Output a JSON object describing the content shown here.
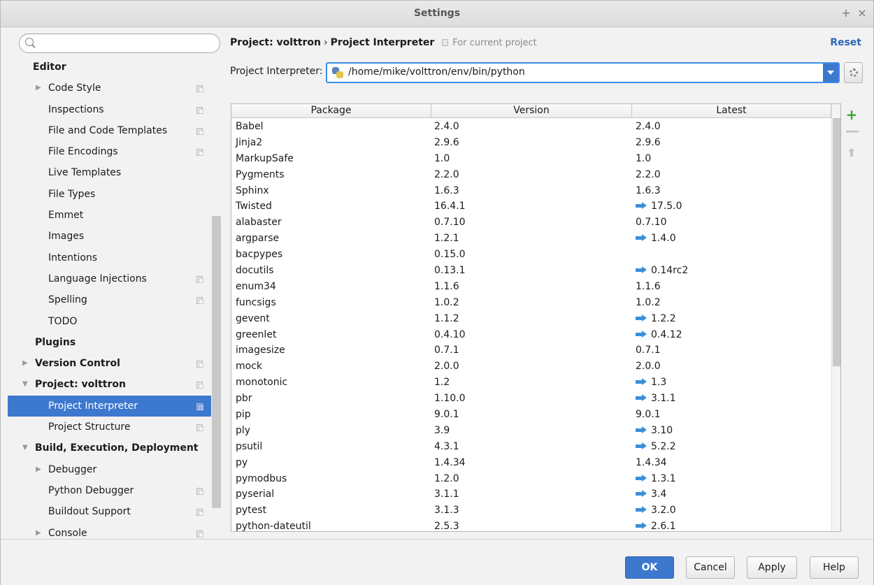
{
  "window": {
    "title": "Settings",
    "pin_glyph": "+",
    "close_glyph": "×"
  },
  "sidebar": {
    "search_placeholder": "",
    "items": [
      {
        "label": "Editor",
        "section": true,
        "arrow": "",
        "copy": false,
        "indent": 36
      },
      {
        "label": "Code Style",
        "section": false,
        "arrow": "▶",
        "copy": true,
        "indent": 58
      },
      {
        "label": "Inspections",
        "section": false,
        "arrow": "",
        "copy": true,
        "indent": 58
      },
      {
        "label": "File and Code Templates",
        "section": false,
        "arrow": "",
        "copy": true,
        "indent": 58
      },
      {
        "label": "File Encodings",
        "section": false,
        "arrow": "",
        "copy": true,
        "indent": 58
      },
      {
        "label": "Live Templates",
        "section": false,
        "arrow": "",
        "copy": false,
        "indent": 58
      },
      {
        "label": "File Types",
        "section": false,
        "arrow": "",
        "copy": false,
        "indent": 58
      },
      {
        "label": "Emmet",
        "section": false,
        "arrow": "",
        "copy": false,
        "indent": 58
      },
      {
        "label": "Images",
        "section": false,
        "arrow": "",
        "copy": false,
        "indent": 58
      },
      {
        "label": "Intentions",
        "section": false,
        "arrow": "",
        "copy": false,
        "indent": 58
      },
      {
        "label": "Language Injections",
        "section": false,
        "arrow": "",
        "copy": true,
        "indent": 58
      },
      {
        "label": "Spelling",
        "section": false,
        "arrow": "",
        "copy": true,
        "indent": 58
      },
      {
        "label": "TODO",
        "section": false,
        "arrow": "",
        "copy": false,
        "indent": 58
      },
      {
        "label": "Plugins",
        "section": true,
        "arrow": "",
        "copy": false,
        "indent": 39
      },
      {
        "label": "Version Control",
        "section": true,
        "arrow": "▶",
        "copy": true,
        "indent": 39
      },
      {
        "label": "Project: volttron",
        "section": true,
        "arrow": "▼",
        "copy": true,
        "indent": 39
      },
      {
        "label": "Project Interpreter",
        "section": false,
        "arrow": "",
        "copy": true,
        "indent": 58,
        "selected": true
      },
      {
        "label": "Project Structure",
        "section": false,
        "arrow": "",
        "copy": true,
        "indent": 58
      },
      {
        "label": "Build, Execution, Deployment",
        "section": true,
        "arrow": "▼",
        "copy": false,
        "indent": 39
      },
      {
        "label": "Debugger",
        "section": false,
        "arrow": "▶",
        "copy": false,
        "indent": 58
      },
      {
        "label": "Python Debugger",
        "section": false,
        "arrow": "",
        "copy": true,
        "indent": 58
      },
      {
        "label": "Buildout Support",
        "section": false,
        "arrow": "",
        "copy": true,
        "indent": 58
      },
      {
        "label": "Console",
        "section": false,
        "arrow": "▶",
        "copy": true,
        "indent": 58
      }
    ]
  },
  "header": {
    "breadcrumb_project": "Project: volttron",
    "breadcrumb_sep": "›",
    "breadcrumb_page": "Project Interpreter",
    "scope_note": "For current project",
    "reset": "Reset"
  },
  "interpreter": {
    "label": "Project Interpreter:",
    "value": "/home/mike/volttron/env/bin/python"
  },
  "table": {
    "columns": [
      "Package",
      "Version",
      "Latest"
    ],
    "rows": [
      {
        "package": "Babel",
        "version": "2.4.0",
        "latest": "2.4.0",
        "upgrade": false
      },
      {
        "package": "Jinja2",
        "version": "2.9.6",
        "latest": "2.9.6",
        "upgrade": false
      },
      {
        "package": "MarkupSafe",
        "version": "1.0",
        "latest": "1.0",
        "upgrade": false
      },
      {
        "package": "Pygments",
        "version": "2.2.0",
        "latest": "2.2.0",
        "upgrade": false
      },
      {
        "package": "Sphinx",
        "version": "1.6.3",
        "latest": "1.6.3",
        "upgrade": false
      },
      {
        "package": "Twisted",
        "version": "16.4.1",
        "latest": "17.5.0",
        "upgrade": true
      },
      {
        "package": "alabaster",
        "version": "0.7.10",
        "latest": "0.7.10",
        "upgrade": false
      },
      {
        "package": "argparse",
        "version": "1.2.1",
        "latest": "1.4.0",
        "upgrade": true
      },
      {
        "package": "bacpypes",
        "version": "0.15.0",
        "latest": "",
        "upgrade": false
      },
      {
        "package": "docutils",
        "version": "0.13.1",
        "latest": "0.14rc2",
        "upgrade": true
      },
      {
        "package": "enum34",
        "version": "1.1.6",
        "latest": "1.1.6",
        "upgrade": false
      },
      {
        "package": "funcsigs",
        "version": "1.0.2",
        "latest": "1.0.2",
        "upgrade": false
      },
      {
        "package": "gevent",
        "version": "1.1.2",
        "latest": "1.2.2",
        "upgrade": true
      },
      {
        "package": "greenlet",
        "version": "0.4.10",
        "latest": "0.4.12",
        "upgrade": true
      },
      {
        "package": "imagesize",
        "version": "0.7.1",
        "latest": "0.7.1",
        "upgrade": false
      },
      {
        "package": "mock",
        "version": "2.0.0",
        "latest": "2.0.0",
        "upgrade": false
      },
      {
        "package": "monotonic",
        "version": "1.2",
        "latest": "1.3",
        "upgrade": true
      },
      {
        "package": "pbr",
        "version": "1.10.0",
        "latest": "3.1.1",
        "upgrade": true
      },
      {
        "package": "pip",
        "version": "9.0.1",
        "latest": "9.0.1",
        "upgrade": false
      },
      {
        "package": "ply",
        "version": "3.9",
        "latest": "3.10",
        "upgrade": true
      },
      {
        "package": "psutil",
        "version": "4.3.1",
        "latest": "5.2.2",
        "upgrade": true
      },
      {
        "package": "py",
        "version": "1.4.34",
        "latest": "1.4.34",
        "upgrade": false
      },
      {
        "package": "pymodbus",
        "version": "1.2.0",
        "latest": "1.3.1",
        "upgrade": true
      },
      {
        "package": "pyserial",
        "version": "3.1.1",
        "latest": "3.4",
        "upgrade": true
      },
      {
        "package": "pytest",
        "version": "3.1.3",
        "latest": "3.2.0",
        "upgrade": true
      },
      {
        "package": "python-dateutil",
        "version": "2.5.3",
        "latest": "2.6.1",
        "upgrade": true
      }
    ]
  },
  "footer": {
    "ok": "OK",
    "cancel": "Cancel",
    "apply": "Apply",
    "help": "Help"
  },
  "colors": {
    "accent": "#3d78cf",
    "upgrade_arrow": "#3b8ed8",
    "add": "#3aa535"
  }
}
